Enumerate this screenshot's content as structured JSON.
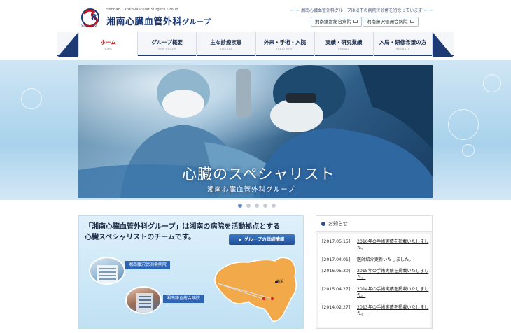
{
  "logo": {
    "since_label": "Since\n2012",
    "english_name": "Shonan Cardiovascular Surgery Group",
    "japanese_name_main": "湘南心臓血管外科",
    "japanese_name_suffix": "グループ"
  },
  "header": {
    "notice": "湘南心臓血管外科グループは以下の病院で診療を行なっています",
    "hospital_links": [
      {
        "label": "湘南鎌倉総合病院"
      },
      {
        "label": "湘南藤沢徳洲会病院"
      }
    ]
  },
  "nav": {
    "items": [
      {
        "jp": "ホーム",
        "en": "HOME",
        "active": true
      },
      {
        "jp": "グループ概要",
        "en": "OUR GROUP",
        "active": false
      },
      {
        "jp": "主な診療疾患",
        "en": "DISEASE",
        "active": false
      },
      {
        "jp": "外来・手術・入院",
        "en": "TREATMENT",
        "active": false
      },
      {
        "jp": "実績・研究業績",
        "en": "RESULT",
        "active": false
      },
      {
        "jp": "入局・研修希望の方",
        "en": "RECRUIT",
        "active": false
      }
    ]
  },
  "hero": {
    "title": "心臓のスペシャリスト",
    "subtitle": "湘南心臓血管外科グループ",
    "slide_count": 5,
    "active_slide": 1
  },
  "intro": {
    "lead_line1": "「湘南心臓血管外科グループ」は湘南の病院を活動拠点とする",
    "lead_line2": "心臓スペシャリストのチームです。",
    "detail_button": "グループの詳細情報",
    "hospital_a": "湘南藤沢徳洲会病院",
    "hospital_b": "湘南鎌倉総合病院",
    "map_city": "横浜"
  },
  "news": {
    "heading": "お知らせ",
    "items": [
      {
        "date": "[2017.05.15]",
        "text": "2016年の手術実績を掲載いたしました。"
      },
      {
        "date": "[2017.04.01]",
        "text": "医師紹介更新いたしました。"
      },
      {
        "date": "[2016.05.30]",
        "text": "2015年の手術実績を掲載いたしました。"
      },
      {
        "date": "[2015.04.27]",
        "text": "2014年の手術実績を掲載いたしました。"
      },
      {
        "date": "[2014.02.27]",
        "text": "2013年の手術実績を掲載いたしました。"
      }
    ]
  },
  "colors": {
    "brand_navy": "#1b3a7a",
    "active_red": "#c3161c",
    "button_blue": "#2c64b6",
    "map_orange": "#f2a94a"
  }
}
